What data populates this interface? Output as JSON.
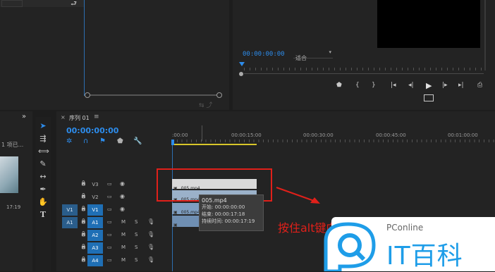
{
  "source_monitor": {
    "top_icon": "import-icon"
  },
  "program_monitor": {
    "timecode": "00:00:00:00",
    "zoom": "适合",
    "controls": [
      "marker-icon",
      "mark-in-icon",
      "mark-out-icon",
      "go-to-in-icon",
      "step-back-icon",
      "play-icon",
      "step-forward-icon",
      "go-to-out-icon",
      "export-frame-icon"
    ]
  },
  "project_panel": {
    "item_label": "1 项已...",
    "thumb_duration": "17:19"
  },
  "sequence": {
    "tab_close": "×",
    "tab_title": "序列 01",
    "tab_menu": "≡",
    "timecode": "00:00:00:00",
    "ruler": [
      ":00:00",
      "00:00:15:00",
      "00:00:30:00",
      "00:00:45:00",
      "00:01:00:00"
    ]
  },
  "tracks": {
    "video": [
      {
        "src": "",
        "name": "V3",
        "lock": "🔒",
        "sync": "▭",
        "eye": "◉"
      },
      {
        "src": "",
        "name": "V2",
        "lock": "🔒",
        "sync": "▭",
        "eye": "◉"
      },
      {
        "src": "V1",
        "name": "V1",
        "lock": "🔒",
        "sync": "▭",
        "eye": "◉"
      }
    ],
    "audio": [
      {
        "src": "A1",
        "name": "A1",
        "lock": "🔒",
        "sync": "▭",
        "m": "M",
        "s": "S"
      },
      {
        "src": "",
        "name": "A2",
        "lock": "🔒",
        "sync": "▭",
        "m": "M",
        "s": "S"
      },
      {
        "src": "",
        "name": "A3",
        "lock": "🔒",
        "sync": "▭",
        "m": "M",
        "s": "S"
      },
      {
        "src": "",
        "name": "A4",
        "lock": "🔒",
        "sync": "▭",
        "m": "M",
        "s": "S"
      }
    ]
  },
  "clips": {
    "v3": "005.mp4",
    "v2": "005.mp4 [V]",
    "v1": "005.mp4"
  },
  "tooltip": {
    "title": "005.mp4",
    "start": "开始: 00:00:00:00",
    "end": "结束: 00:00:17:18",
    "duration": "持续时间: 00:00:17:19"
  },
  "annotation": {
    "text": "按住alt键向上拖动"
  },
  "watermark": {
    "brand": "PConline",
    "name": "IT百科"
  },
  "colors": {
    "accent": "#2d8ceb",
    "red": "#e0201a"
  }
}
